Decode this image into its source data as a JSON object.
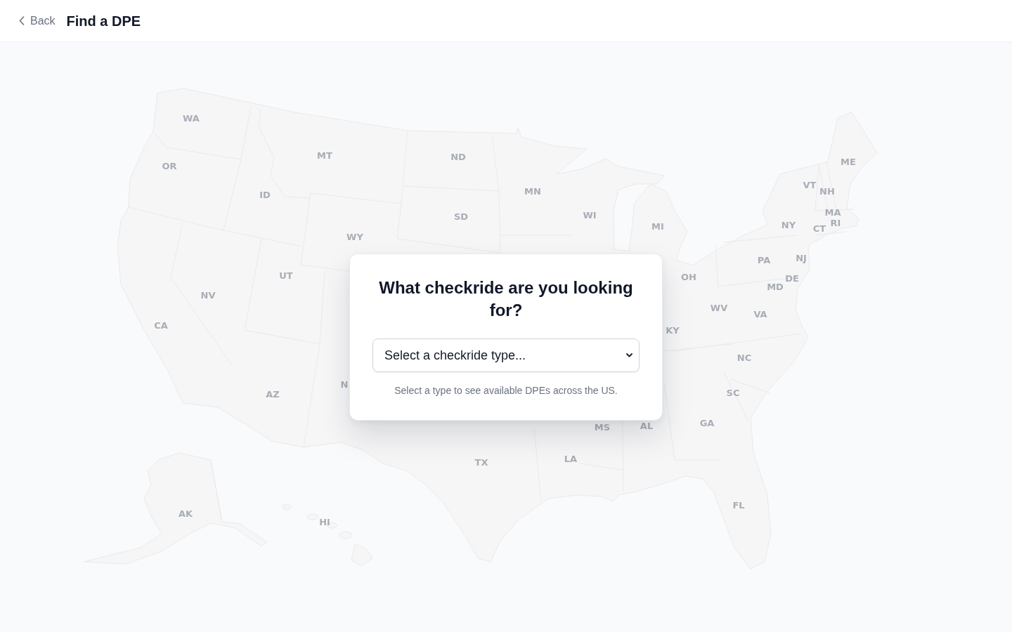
{
  "header": {
    "back_label": "Back",
    "title": "Find a DPE"
  },
  "map": {
    "state_labels": [
      "WA",
      "OR",
      "ID",
      "MT",
      "WY",
      "NV",
      "UT",
      "CA",
      "AZ",
      "N",
      "ND",
      "SD",
      "MN",
      "WI",
      "MI",
      "OH",
      "KY",
      "TX",
      "LA",
      "MS",
      "AL",
      "GA",
      "FL",
      "SC",
      "NC",
      "VA",
      "WV",
      "MD",
      "DE",
      "PA",
      "NJ",
      "NY",
      "CT",
      "RI",
      "MA",
      "VT",
      "NH",
      "ME",
      "AK",
      "HI"
    ]
  },
  "prompt_card": {
    "title": "What checkride are you looking for?",
    "select": {
      "placeholder": "Select a checkride type..."
    },
    "hint": "Select a type to see available DPEs across the US."
  }
}
